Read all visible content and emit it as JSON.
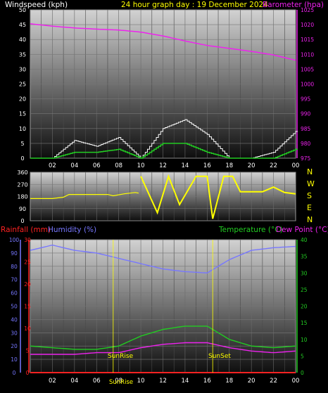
{
  "header": {
    "wind_label": "Windspeed (kph)",
    "title": "24 hour graph day : 19 December 2024",
    "baro_label": "Barometer (hpa)"
  },
  "mid_header": {
    "rain_label": "Rainfall (mm)",
    "humidity_label": "Humidity (%)",
    "temp_label": "Temperature (°C)",
    "dew_label": "Dew Point (°C)"
  },
  "time_ticks": [
    "02",
    "04",
    "06",
    "08",
    "10",
    "12",
    "14",
    "16",
    "18",
    "20",
    "22",
    "00"
  ],
  "compass_labels": [
    "N",
    "W",
    "S",
    "E",
    "N"
  ],
  "sun_labels": {
    "sunrise": "SunRise",
    "sunset": "SunSet",
    "sunrise_bottom": "SunRise"
  },
  "colors": {
    "wind": "#ffffff",
    "gust": "#ffffff",
    "wind_avg": "#22cc22",
    "barometer": "#ee22ee",
    "direction": "#ffff00",
    "humidity": "#7777ff",
    "temperature": "#22cc22",
    "dewpoint": "#ee22ee",
    "rainfall": "#ff2222"
  },
  "chart_data": [
    {
      "type": "line",
      "title": "24 hour graph day : 19 December 2024",
      "x": [
        0,
        2,
        4,
        6,
        8,
        10,
        12,
        14,
        16,
        18,
        20,
        22,
        24
      ],
      "ylabel": "Windspeed (kph)",
      "ylim": [
        0,
        50
      ],
      "y_ticks": [
        0,
        5,
        10,
        15,
        20,
        25,
        30,
        35,
        40,
        45,
        50
      ],
      "y2label": "Barometer (hpa)",
      "y2lim": [
        975,
        1025
      ],
      "y2_ticks": [
        975,
        980,
        985,
        990,
        995,
        1000,
        1005,
        1010,
        1015,
        1020,
        1025
      ],
      "series": [
        {
          "name": "Barometer (hpa)",
          "axis": "right",
          "values": [
            1020.3,
            1019.5,
            1018.9,
            1018.5,
            1018.2,
            1017.5,
            1016.2,
            1014.5,
            1013.0,
            1012.0,
            1011.0,
            1009.8,
            1008.0
          ]
        },
        {
          "axis": "left",
          "values": [
            0,
            0,
            2,
            2,
            3,
            0,
            5,
            5,
            2,
            0,
            0,
            0,
            3
          ]
        },
        {
          "axis": "left",
          "values": [
            0,
            0,
            6,
            4,
            7,
            0,
            10,
            13,
            8,
            0,
            0,
            2,
            9
          ]
        }
      ]
    },
    {
      "type": "scatter",
      "ylim": [
        0,
        360
      ],
      "y_ticks": [
        0,
        90,
        180,
        270,
        360
      ],
      "series": [
        {
          "x": [
            0,
            2,
            3,
            3.5,
            5,
            7,
            7.5,
            8.5,
            9.5,
            9.8
          ],
          "values": [
            165,
            165,
            175,
            195,
            195,
            195,
            185,
            200,
            210,
            205
          ]
        },
        {
          "x": [
            10,
            11.5,
            12.5,
            13.5,
            15,
            16,
            16.5,
            17.5,
            18.3,
            19,
            21,
            22,
            23,
            24
          ],
          "values": [
            330,
            60,
            330,
            120,
            330,
            330,
            15,
            330,
            330,
            215,
            215,
            250,
            210,
            200
          ]
        }
      ]
    },
    {
      "type": "line",
      "x": [
        0,
        2,
        4,
        6,
        8,
        10,
        12,
        14,
        16,
        18,
        20,
        22,
        24
      ],
      "ylabel": "Humidity (%)",
      "ylim": [
        0,
        100
      ],
      "y_ticks": [
        0,
        10,
        20,
        30,
        40,
        50,
        60,
        70,
        80,
        90,
        100
      ],
      "y_rain_label": "Rainfall (mm)",
      "y_rain_lim": [
        0,
        30
      ],
      "y_rain_ticks": [
        0,
        5,
        10,
        15,
        20,
        25,
        30
      ],
      "y2label": "Temperature (°C)",
      "y2lim": [
        0,
        40
      ],
      "y2_ticks": [
        0,
        5,
        10,
        15,
        20,
        25,
        30,
        35,
        40
      ],
      "series": [
        {
          "name": "Humidity (%)",
          "axis": "humidity",
          "values": [
            92,
            96,
            92,
            90,
            86,
            82,
            78,
            76,
            75,
            85,
            92,
            94,
            95
          ]
        },
        {
          "name": "Temperature (°C)",
          "axis": "right",
          "values": [
            8,
            7.5,
            7,
            7,
            8,
            11,
            13,
            14,
            14,
            10,
            8,
            7.5,
            8
          ]
        },
        {
          "name": "Dew Point (°C)",
          "axis": "right",
          "values": [
            5.5,
            5.5,
            5.5,
            6,
            6,
            7.5,
            8.5,
            9,
            9,
            7.5,
            6.5,
            6,
            6.5
          ]
        },
        {
          "name": "Rainfall (mm)",
          "axis": "rain",
          "values": [
            0,
            0,
            0,
            0,
            0,
            0,
            0,
            0,
            0,
            0,
            0,
            0,
            0
          ]
        }
      ],
      "annotations": [
        {
          "label": "SunRise",
          "x": 7.5
        },
        {
          "label": "SunSet",
          "x": 16.5
        }
      ]
    }
  ]
}
